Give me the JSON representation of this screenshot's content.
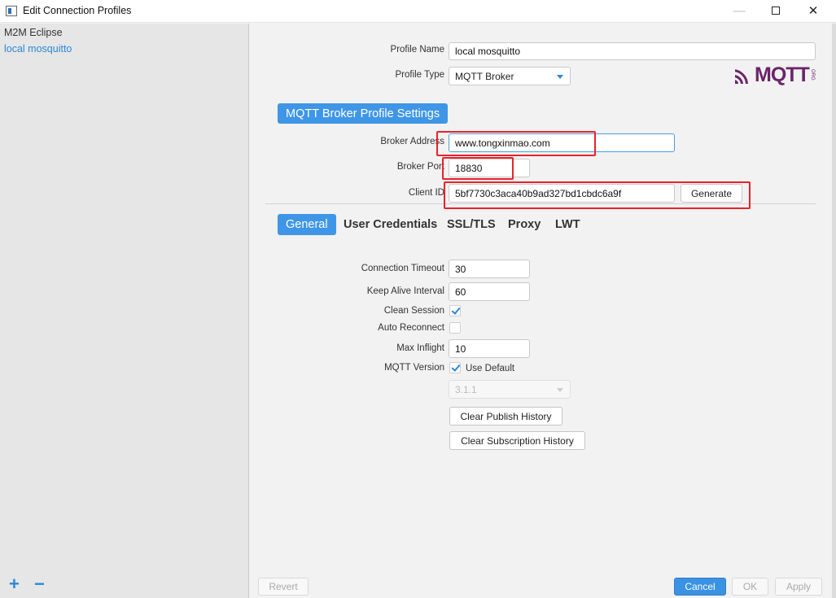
{
  "window": {
    "title": "Edit Connection Profiles",
    "controls": {
      "minimize": "—",
      "close": "✕"
    }
  },
  "sidebar": {
    "items": [
      {
        "label": "M2M Eclipse",
        "selected": false
      },
      {
        "label": "local mosquitto",
        "selected": true
      }
    ],
    "add_label": "+",
    "remove_label": "−"
  },
  "profile": {
    "name_label": "Profile Name",
    "name_value": "local mosquitto",
    "type_label": "Profile Type",
    "type_value": "MQTT Broker",
    "logo_text": "MQTT",
    "logo_suffix": "ORG"
  },
  "broker_section": {
    "title": "MQTT Broker Profile Settings",
    "address_label": "Broker Address",
    "address_value": "www.tongxinmao.com",
    "port_label": "Broker Port",
    "port_value": "18830",
    "client_id_label": "Client ID",
    "client_id_value": "5bf7730c3aca40b9ad327bd1cbdc6a9f",
    "generate_label": "Generate"
  },
  "tabs": [
    {
      "label": "General",
      "active": true
    },
    {
      "label": "User Credentials",
      "active": false
    },
    {
      "label": "SSL/TLS",
      "active": false
    },
    {
      "label": "Proxy",
      "active": false
    },
    {
      "label": "LWT",
      "active": false
    }
  ],
  "general": {
    "connection_timeout_label": "Connection Timeout",
    "connection_timeout_value": "30",
    "keep_alive_label": "Keep Alive Interval",
    "keep_alive_value": "60",
    "clean_session_label": "Clean Session",
    "clean_session_checked": true,
    "auto_reconnect_label": "Auto Reconnect",
    "auto_reconnect_checked": false,
    "max_inflight_label": "Max Inflight",
    "max_inflight_value": "10",
    "mqtt_version_label": "MQTT Version",
    "use_default_label": "Use Default",
    "use_default_checked": true,
    "version_value": "3.1.1",
    "clear_publish_label": "Clear Publish History",
    "clear_subscription_label": "Clear Subscription History"
  },
  "footer": {
    "revert_label": "Revert",
    "cancel_label": "Cancel",
    "ok_label": "OK",
    "apply_label": "Apply"
  },
  "colors": {
    "accent": "#3f96e6",
    "highlight_box": "#e8232a",
    "logo": "#6b2468"
  }
}
